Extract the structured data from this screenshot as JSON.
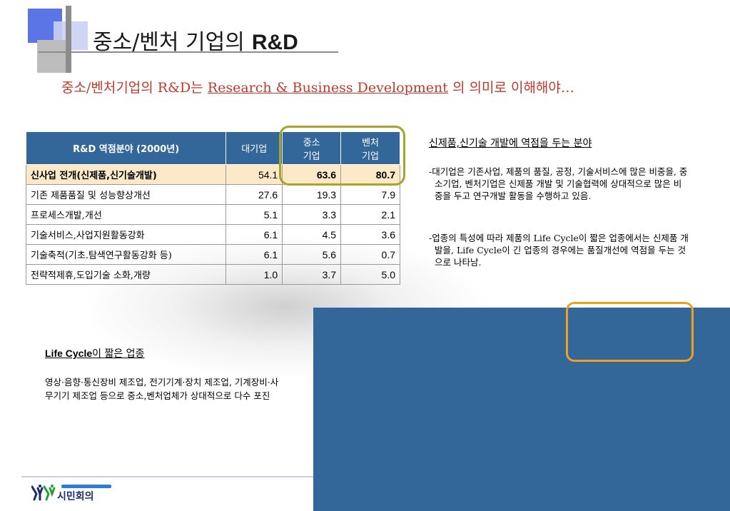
{
  "title": {
    "main": "중소/벤처 기업의",
    "bold": "R&D"
  },
  "subtitle": {
    "prefix": "중소/벤처기업의 R&D는 ",
    "underlined": "Research & Business Development",
    "suffix": " 의 의미로 이해해야…"
  },
  "table": {
    "headers": [
      "R&D 역점분야 (2000년)",
      "대기업",
      "중소\n기업",
      "벤처\n기업"
    ],
    "rows": [
      {
        "label": "신사업 전개(신제품,신기술개발)",
        "large": "54.1",
        "sme": "63.6",
        "venture": "80.7"
      },
      {
        "label": "기존 제품품질 및 성능향상개선",
        "large": "27.6",
        "sme": "19.3",
        "venture": "7.9"
      },
      {
        "label": "프로세스개발,개선",
        "large": "5.1",
        "sme": "3.3",
        "venture": "2.1"
      },
      {
        "label": "기술서비스,사업지원활동강화",
        "large": "6.1",
        "sme": "4.5",
        "venture": "3.6"
      },
      {
        "label": "기술축적(기초.탐색연구활동강화 등)",
        "large": "6.1",
        "sme": "5.6",
        "venture": "0.7"
      },
      {
        "label": "전략적제휴,도입기술 소화,개량",
        "large": "1.0",
        "sme": "3.7",
        "venture": "5.0"
      }
    ]
  },
  "right": {
    "heading": "신제품,신기술 개발에 역점을 두는 분야",
    "p1": "-대기업은 기존사업, 제품의 품질, 공정, 기술서비스에 많은 비중을, 중소기업, 벤처기업은 신제품 개발 및 기술협력에 상대적으로 많은 비중을 두고 연구개발 활동을 수행하고 있음.",
    "p2": "-업종의 특성에 따라 제품의 Life Cycle이 짧은 업종에서는 신제품 개발을, Life Cycle이 긴 업종의 경우에는 품질개선에 역점을 두는 것으로 나타남."
  },
  "lifecycle": {
    "heading_bold": "Life Cycle",
    "heading_rest": "이 짧은 업종",
    "body": "영상·음향·통신장비 제조업, 전기기계·장치 제조업, 기계장비·사무기기 제조업 등으로 중소,벤처업체가 상대적으로 다수 포진"
  },
  "logo": {
    "name": "시민회의"
  },
  "colors": {
    "table_header": "#336699",
    "highlight_row": "#fde9c8",
    "olive_box": "#a5a52a",
    "orange_box": "#f0a020",
    "subtitle": "#c0392b"
  }
}
